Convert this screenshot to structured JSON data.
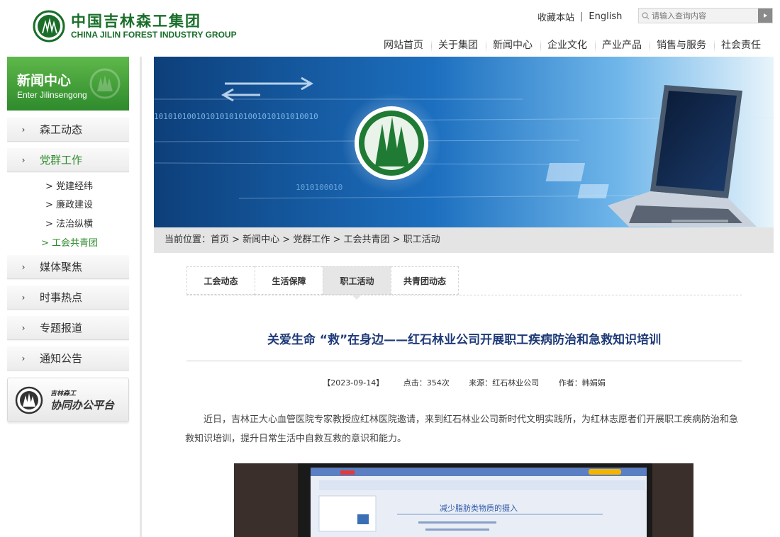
{
  "header": {
    "logo_cn": "中国吉林森工集团",
    "logo_en": "CHINA JILIN FOREST INDUSTRY GROUP",
    "favorite": "收藏本站",
    "divider": "|",
    "english": "English",
    "search_placeholder": "请输入查询内容",
    "nav": [
      "网站首页",
      "关于集团",
      "新闻中心",
      "企业文化",
      "产业产品",
      "销售与服务",
      "社会责任"
    ]
  },
  "sidebar": {
    "title_cn": "新闻中心",
    "title_en": "Enter Jilinsengong",
    "menu_top": [
      {
        "label": "森工动态",
        "arrow": "›"
      },
      {
        "label": "党群工作",
        "arrow": "›"
      }
    ],
    "sub": [
      "> 党建经纬",
      "> 廉政建设",
      "> 法治纵横",
      "> 工会共青团"
    ],
    "menu_bottom": [
      {
        "label": "媒体聚焦",
        "arrow": "›"
      },
      {
        "label": "时事热点",
        "arrow": "›"
      },
      {
        "label": "专题报道",
        "arrow": "›"
      },
      {
        "label": "通知公告",
        "arrow": "›"
      }
    ],
    "office_small": "吉林森工",
    "office_big": "协同办公平台"
  },
  "banner": {
    "binary_1": "10101010010101010101001010101010010",
    "binary_2": "1010100010"
  },
  "breadcrumb": "当前位置：首页 > 新闻中心 > 党群工作 > 工会共青团 > 职工活动",
  "tabs": [
    "工会动态",
    "生活保障",
    "职工活动",
    "共青团动态"
  ],
  "article": {
    "title": "关爱生命 “救”在身边——红石林业公司开展职工疾病防治和急救知识培训",
    "date": "【2023-09-14】",
    "clicks": "点击：354次",
    "source": "来源：红石林业公司",
    "author": "作者：韩娟娟",
    "paragraph": "近日，吉林正大心血管医院专家教授应红林医院邀请，来到红石林业公司新时代文明实践所，为红林志愿者们开展职工疾病防治和急救知识培训，提升日常生活中自救互救的意识和能力。",
    "slide_heading": "减少脂肪类物质的摄入"
  },
  "colors": {
    "brand_green": "#2e8a2c",
    "title_blue": "#1e3a78"
  }
}
